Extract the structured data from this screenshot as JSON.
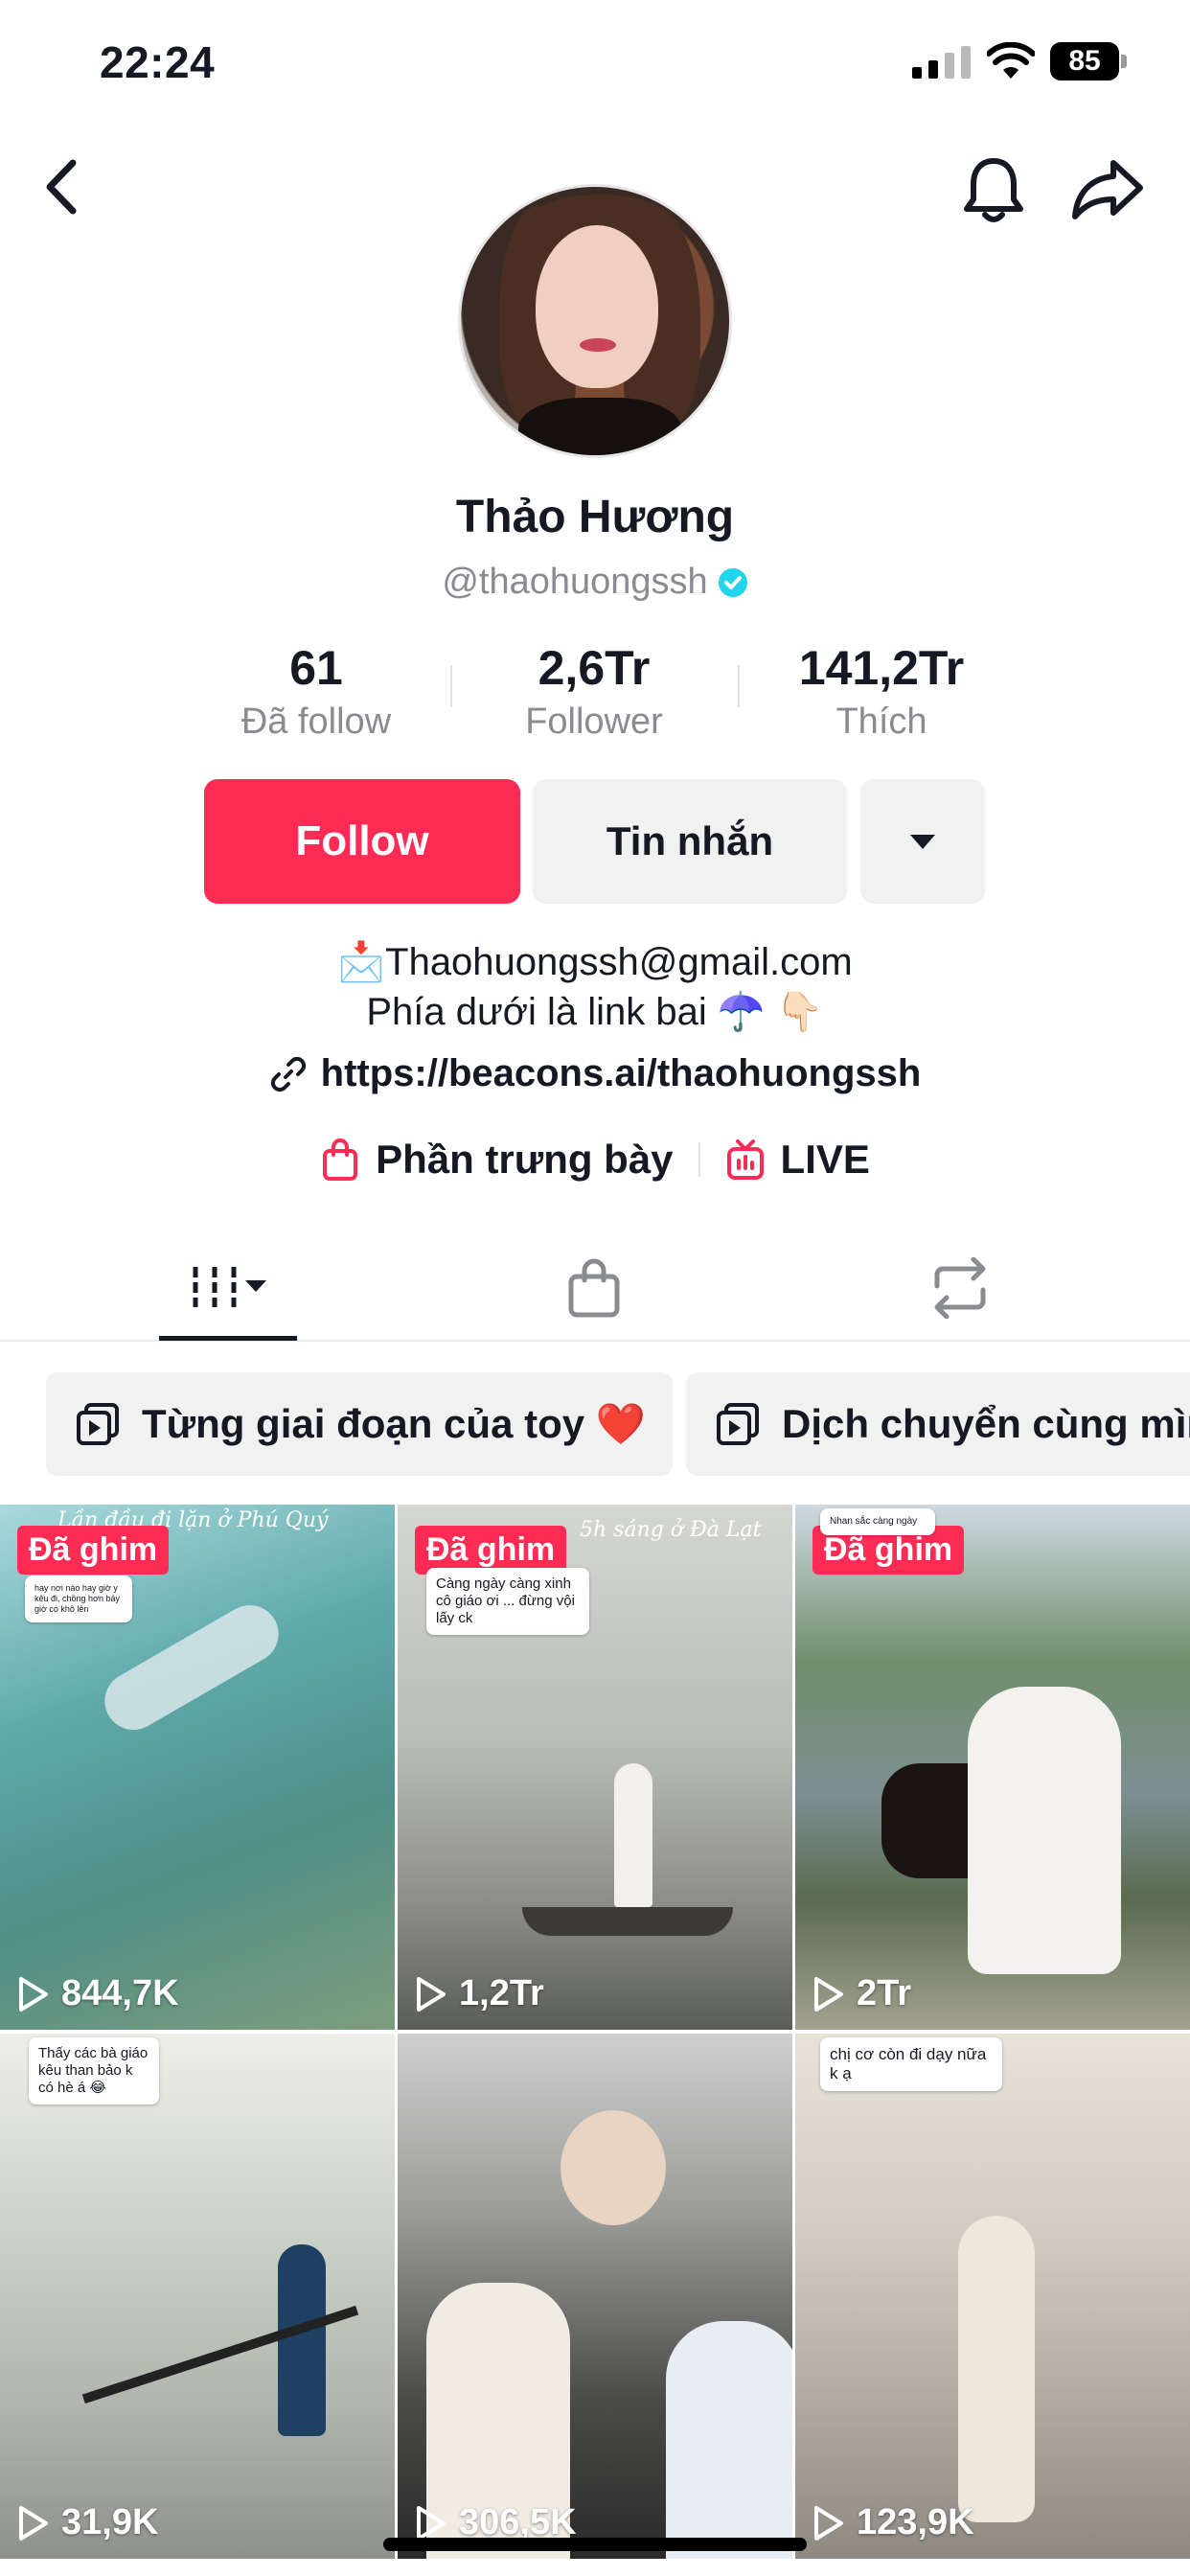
{
  "status_bar": {
    "time": "22:24",
    "battery": "85"
  },
  "profile": {
    "name": "Thảo Hương",
    "handle": "@thaohuongssh",
    "stats": [
      {
        "value": "61",
        "label": "Đã follow"
      },
      {
        "value": "2,6Tr",
        "label": "Follower"
      },
      {
        "value": "141,2Tr",
        "label": "Thích"
      }
    ]
  },
  "actions": {
    "follow_label": "Follow",
    "message_label": "Tin nhắn"
  },
  "bio": {
    "line1": "📩Thaohuongssh@gmail.com",
    "line2": "Phía dưới là link bai ☂️ 👇🏻",
    "link": "https://beacons.ai/thaohuongssh"
  },
  "shortcuts": {
    "showcase_label": "Phần trưng bày",
    "live_label": "LIVE"
  },
  "playlists": [
    {
      "label": "Từng giai đoạn của toy ❤️"
    },
    {
      "label": "Dịch chuyển cùng mìn"
    }
  ],
  "videos": [
    {
      "views": "844,7K",
      "pinned": "Đã ghim",
      "overlay": "Lần đầu đi lặn ở Phú Quý",
      "comment": "hay nơi nào hay giờ y kêu đi, chồng hơn bảy giờ có khô lên"
    },
    {
      "views": "1,2Tr",
      "pinned": "Đã ghim",
      "overlay": "5h sáng ở Đà Lạt",
      "comment": "Càng ngày càng xinh cô giáo ơi ... đừng vội lấy ck"
    },
    {
      "views": "2Tr",
      "pinned": "Đã ghim",
      "overlay": "",
      "comment": "Nhan sắc càng ngày"
    },
    {
      "views": "31,9K",
      "pinned": "",
      "overlay": "",
      "comment": "Thấy các bà giáo kêu than bảo k có hè á 😂"
    },
    {
      "views": "306,5K",
      "pinned": "",
      "overlay": "",
      "comment": ""
    },
    {
      "views": "123,9K",
      "pinned": "",
      "overlay": "",
      "comment": "chị cơ còn đi dạy nữa k ạ"
    }
  ],
  "colors": {
    "accent": "#fe2c55",
    "secondary_text": "#8a8b91",
    "chip_bg": "#f1f1f2",
    "verified": "#20d5ec"
  },
  "icons": {
    "nav": [
      "back-arrow-icon",
      "bell-icon",
      "share-icon"
    ],
    "tabs": [
      "videos-grid-icon",
      "shop-bag-icon",
      "repost-icon"
    ]
  }
}
